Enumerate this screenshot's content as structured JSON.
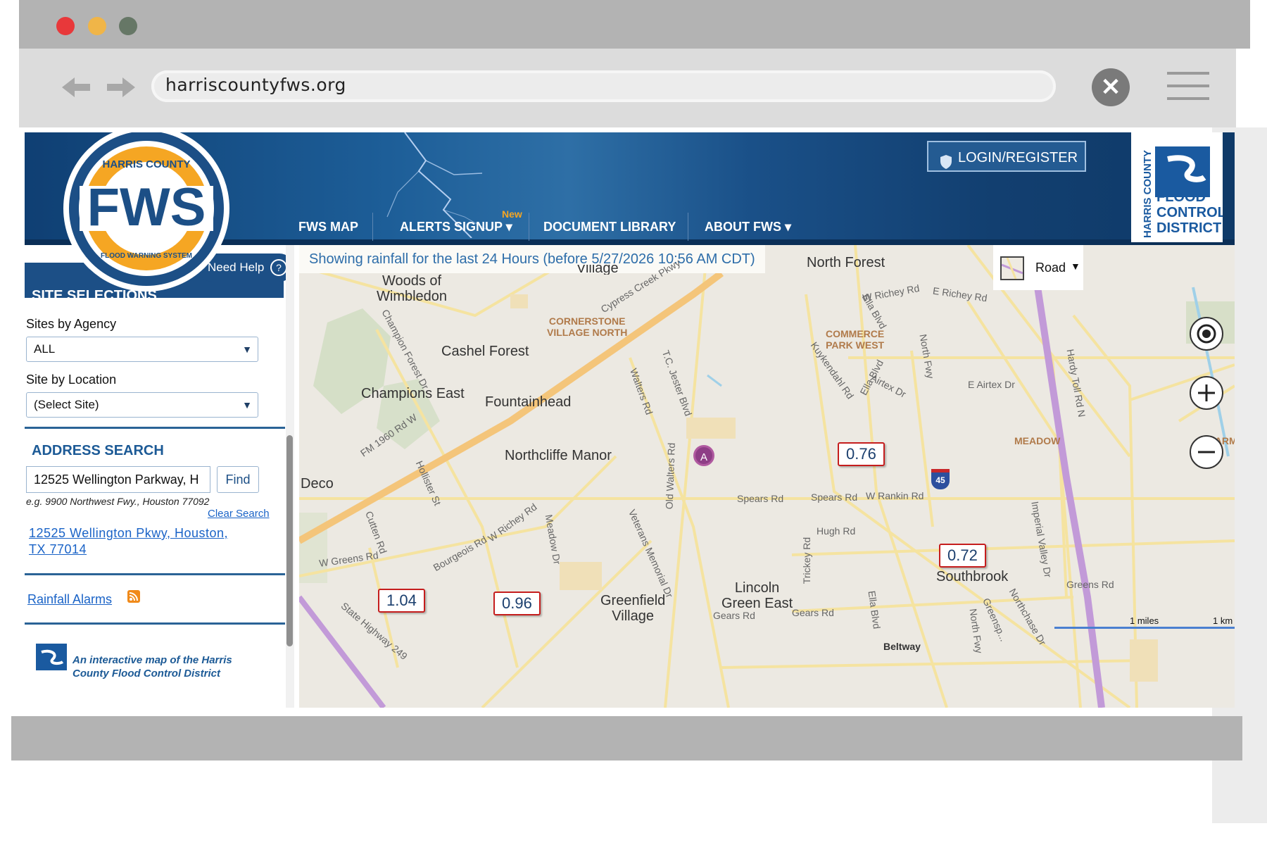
{
  "browser": {
    "url": "harriscountyfws.org"
  },
  "header": {
    "logo_text": "FWS",
    "logo_ring_top": "HARRIS COUNTY",
    "logo_ring_bottom": "FLOOD WARNING SYSTEM",
    "login_label": "LOGIN/REGISTER",
    "nav": [
      {
        "label": "FWS MAP"
      },
      {
        "label": "ALERTS SIGNUP",
        "badge": "New"
      },
      {
        "label": "DOCUMENT LIBRARY"
      },
      {
        "label": "ABOUT FWS"
      }
    ],
    "district_logo": {
      "line1": "HARRIS COUNTY",
      "line2": "FLOOD",
      "line3": "CONTROL",
      "line4": "DISTRICT"
    }
  },
  "sidebar": {
    "need_help": "Need Help",
    "section_title": "SITE SELECTIONS",
    "sites_by_agency_label": "Sites by Agency",
    "sites_by_agency_value": "ALL",
    "site_by_location_label": "Site by Location",
    "site_by_location_value": "(Select Site)",
    "address_search_title": "ADDRESS SEARCH",
    "address_input_value": "12525 Wellington Parkway, H",
    "find_label": "Find",
    "example_text": "e.g. 9900 Northwest Fwy., Houston 77092",
    "clear_search": "Clear Search",
    "result_line1": "12525 Wellington Pkwy, Houston,",
    "result_line2": "TX 77014",
    "rainfall_alarms": "Rainfall Alarms",
    "footer_text_line1": "An interactive map of the Harris",
    "footer_text_line2": "County Flood Control District"
  },
  "map": {
    "banner": "Showing rainfall for the last 24 Hours (before 5/27/2026 10:56 AM CDT)",
    "layer_select": "Road",
    "marker_label": "A",
    "rain_gauges": [
      "0.76",
      "0.72",
      "1.04",
      "0.96"
    ],
    "places": {
      "north_forest": "North Forest",
      "woods_1": "Woods of",
      "woods_2": "Wimbledon",
      "village": "Village",
      "cashel": "Cashel Forest",
      "champions": "Champions East",
      "fountain": "Fountainhead",
      "northcliffe": "Northcliffe Manor",
      "deco": "Deco",
      "greenfield_1": "Greenfield",
      "greenfield_2": "Village",
      "lincoln_1": "Lincoln",
      "lincoln_2": "Green East",
      "southbrook": "Southbrook",
      "cornerstone_1": "CORNERSTONE",
      "cornerstone_2": "VILLAGE NORTH",
      "commerce_1": "COMMERCE",
      "commerce_2": "PARK WEST",
      "meadow": "MEADOW",
      "farms": "FARMS"
    },
    "roads": {
      "w_richey": "W Richey Rd",
      "e_richey": "E Richey Rd",
      "cypress_creek": "Cypress Creek Pkwy",
      "champion_forest": "Champion Forest Dr",
      "ella_blvd_top": "Ella Blvd",
      "ella_blvd_mid": "Ella Blvd",
      "ella_blvd_bottom": "Ella Blvd",
      "kuykendahl": "Kuykendahl Rd",
      "airtex": "Airtex Dr",
      "e_airtex": "E Airtex Dr",
      "tc_jester": "T.C. Jester Blvd",
      "walters": "Walters Rd",
      "old_walters": "Old Walters Rd",
      "fm1960": "FM 1960 Rd W",
      "hollister": "Hollister St",
      "cutten": "Cutten Rd",
      "w_greens": "W Greens Rd",
      "bourgeois": "Bourgeois Rd",
      "w_richey_low": "W Richey Rd",
      "meadow_dr": "Meadow Dr",
      "veterans": "Veterans Memorial Dr",
      "spears_1": "Spears Rd",
      "spears_2": "Spears Rd",
      "w_rankin": "W Rankin Rd",
      "hugh": "Hugh Rd",
      "trickey": "Trickey Rd",
      "gears_1": "Gears Rd",
      "gears_2": "Gears Rd",
      "state_hwy": "State Highway 249",
      "northfwy_top": "North Fwy",
      "northfwy_bottom": "North Fwy",
      "hardy": "Hardy Toll Rd N",
      "imperial": "Imperial Valley Dr",
      "greens_rd": "Greens Rd",
      "northchase": "Northchase Dr",
      "greensp": "Greensp...",
      "beltway": "Beltway",
      "i45": "45"
    },
    "scale": {
      "miles": "1 miles",
      "km": "1 km"
    }
  }
}
